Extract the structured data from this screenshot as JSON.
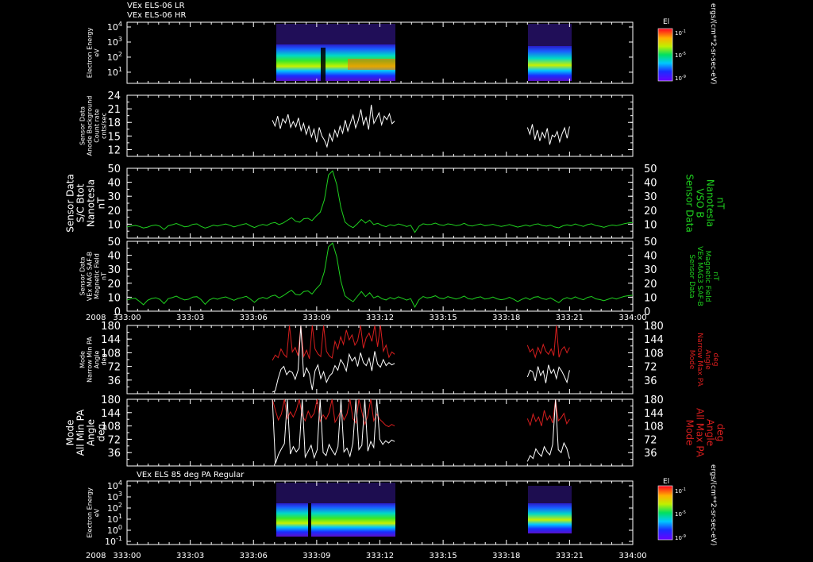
{
  "header": {
    "line1": "VEx ELS-06 LR",
    "line2": "VEx ELS-06 HR"
  },
  "time_axis": {
    "year": "2008",
    "ticks": [
      "333:00",
      "333:03",
      "333:06",
      "333:09",
      "333:12",
      "333:15",
      "333:18",
      "333:21",
      "334:00"
    ]
  },
  "colorbar_units": "ergs/(cm**2-sr-sec-eV)",
  "colors": {
    "green": "#1fd21f",
    "red": "#d81e1e",
    "white": "#ffffff",
    "black": "#000000"
  },
  "chart_data": [
    {
      "type": "heatmap",
      "id": "spec1",
      "ylabel": [
        "Electron Energy",
        "eV"
      ],
      "yticks": [
        "10^4",
        "10^3",
        "10^2",
        "10^1"
      ],
      "colorbar": {
        "label": "El",
        "ticks": [
          "10^-1",
          "10^-5",
          "10^-9"
        ]
      },
      "data_intervals": [
        [
          "333:06.9",
          "333:12.7"
        ],
        [
          "333:19.0",
          "333:21.0"
        ]
      ],
      "note_features": [
        {
          "t": 9.4,
          "kind": "dropout"
        },
        {
          "t": 10.2,
          "kind": "low-energy enhancement"
        }
      ]
    },
    {
      "type": "line",
      "id": "bkg",
      "ylabel": [
        "Sensor Data",
        "Anode Background",
        "Count rate",
        "cnts/sec"
      ],
      "yticks": [
        24,
        21,
        18,
        15,
        12
      ],
      "ylim": [
        10.5,
        24
      ],
      "series": [
        {
          "color": "white",
          "segments": [
            {
              "x_start": 6.9,
              "x_end": 12.7,
              "values": [
                18.5,
                17.2,
                19.4,
                16.6,
                18.8,
                17.9,
                19.8,
                16.9,
                18.2,
                17.0,
                19.0,
                16.2,
                17.8,
                15.4,
                17.2,
                14.8,
                16.5,
                13.6,
                16.9,
                15.0,
                14.1,
                12.6,
                15.5,
                13.9,
                16.3,
                14.8,
                17.2,
                15.6,
                18.5,
                16.1,
                17.9,
                19.6,
                16.8,
                18.4,
                20.9,
                17.5,
                19.1,
                16.4,
                21.9,
                17.8,
                18.9,
                20.1,
                17.5,
                19.4,
                18.6,
                19.9,
                17.7,
                18.3
              ]
            },
            {
              "x_start": 19.0,
              "x_end": 21.0,
              "values": [
                16.9,
                15.4,
                17.6,
                14.2,
                16.3,
                13.9,
                15.8,
                14.6,
                16.7,
                13.1,
                15.2,
                14.8,
                16.0,
                13.7,
                15.5,
                16.8,
                14.5,
                17.1
              ]
            }
          ]
        }
      ]
    },
    {
      "type": "line",
      "id": "bvso",
      "ylabel": [
        "Sensor Data",
        "S/C Btot",
        "Nanotesla",
        "nT"
      ],
      "rlabel": [
        "Sensor Data",
        "VSO B",
        "Nanotesla",
        "nT"
      ],
      "yticks": [
        50,
        40,
        30,
        20,
        10
      ],
      "ylim": [
        0,
        50
      ],
      "series": [
        {
          "color": "green",
          "values": [
            8.2,
            8.7,
            9.1,
            8.4,
            7.3,
            7.9,
            9.0,
            9.4,
            8.6,
            6.2,
            8.8,
            9.6,
            10.5,
            9.3,
            8.1,
            8.5,
            9.9,
            10.2,
            8.4,
            7.2,
            8.1,
            9.3,
            8.7,
            9.5,
            10.1,
            9.2,
            8.0,
            8.9,
            9.7,
            10.4,
            8.8,
            7.6,
            8.9,
            9.8,
            9.1,
            10.6,
            11.2,
            9.7,
            10.9,
            12.8,
            14.6,
            12.1,
            11.4,
            13.9,
            14.2,
            12.5,
            15.8,
            18.6,
            27.5,
            45.2,
            48.1,
            38.4,
            22.1,
            11.6,
            9.0,
            7.5,
            10.2,
            13.4,
            10.8,
            12.9,
            9.7,
            10.6,
            9.1,
            8.2,
            9.6,
            8.9,
            10.1,
            9.4,
            8.3,
            9.2,
            4.1,
            8.5,
            10.3,
            9.7,
            9.9,
            10.8,
            9.6,
            9.1,
            10.2,
            9.8,
            8.9,
            9.4,
            10.6,
            9.1,
            8.7,
            9.5,
            10.1,
            8.9,
            9.3,
            9.9,
            9.0,
            8.4,
            8.9,
            9.7,
            8.8,
            7.9,
            8.6,
            9.4,
            8.5,
            9.8,
            10.2,
            9.1,
            8.6,
            9.3,
            8.0,
            7.4,
            8.8,
            9.5,
            8.9,
            10.1,
            9.2,
            8.4,
            9.7,
            10.3,
            9.0,
            8.5,
            7.8,
            8.7,
            9.4,
            8.9,
            9.6,
            10.4,
            10.9,
            11.2
          ]
        }
      ]
    },
    {
      "type": "line",
      "id": "bmag",
      "ylabel": [
        "Sensor Data",
        "VEx MAG SAF-B",
        "Magnetic Field",
        "nT"
      ],
      "rlabel": [
        "Sensor Data",
        "VEx MAG3 SAF-B",
        "Magnetic Field",
        "nT"
      ],
      "yticks": [
        50,
        40,
        30,
        20,
        10,
        0
      ],
      "ylim": [
        0,
        50
      ],
      "series": [
        {
          "color": "green",
          "values": [
            8.0,
            8.9,
            9.2,
            7.1,
            4.6,
            7.8,
            9.1,
            9.6,
            8.4,
            5.4,
            8.9,
            9.7,
            10.8,
            9.2,
            8.0,
            8.6,
            10.1,
            10.4,
            8.3,
            4.9,
            8.0,
            9.4,
            8.5,
            9.6,
            10.2,
            9.0,
            7.8,
            9.1,
            9.8,
            10.6,
            8.6,
            6.3,
            8.8,
            9.9,
            9.0,
            10.7,
            11.5,
            9.5,
            11.1,
            13.2,
            15.0,
            12.0,
            11.6,
            14.1,
            14.5,
            12.3,
            16.0,
            19.1,
            28.4,
            46.0,
            48.8,
            39.0,
            21.6,
            11.0,
            8.6,
            6.8,
            10.5,
            14.1,
            10.4,
            13.2,
            9.5,
            10.8,
            8.9,
            8.0,
            9.8,
            8.7,
            10.3,
            9.2,
            7.9,
            9.0,
            2.9,
            8.2,
            10.5,
            9.5,
            10.0,
            11.0,
            9.4,
            8.9,
            10.4,
            9.6,
            8.7,
            9.5,
            10.8,
            8.9,
            8.5,
            9.7,
            10.3,
            8.7,
            9.1,
            10.1,
            8.8,
            8.2,
            8.7,
            9.9,
            8.6,
            6.9,
            8.4,
            9.6,
            8.3,
            10.0,
            10.4,
            8.9,
            8.4,
            9.5,
            7.8,
            6.1,
            8.6,
            9.7,
            8.7,
            10.3,
            9.0,
            8.2,
            9.9,
            10.5,
            8.8,
            8.3,
            7.5,
            8.5,
            9.6,
            8.7,
            9.8,
            10.6,
            11.1,
            11.4
          ]
        }
      ]
    },
    {
      "type": "line",
      "id": "pa1",
      "ylabel": [
        "Mode",
        "Narrow Min PA",
        "Angle",
        "deg"
      ],
      "rlabel": [
        "Mode",
        "Narrow Max PA",
        "Angle",
        "deg"
      ],
      "yticks": [
        180,
        144,
        108,
        72,
        36
      ],
      "ylim": [
        0,
        180
      ],
      "series": [
        {
          "name": "max",
          "color": "red",
          "segments": [
            {
              "x_start": 6.9,
              "x_end": 12.7,
              "values": [
                88,
                102,
                95,
                118,
                104,
                96,
                180,
                110,
                122,
                100,
                180,
                98,
                115,
                92,
                180,
                118,
                105,
                98,
                180,
                112,
                100,
                94,
                138,
                118,
                150,
                130,
                168,
                142,
                155,
                128,
                140,
                180,
                120,
                148,
                160,
                138,
                180,
                124,
                180,
                112,
                128,
                96,
                110,
                104
              ]
            },
            {
              "x_start": 19.0,
              "x_end": 21.0,
              "values": [
                128,
                110,
                118,
                96,
                122,
                106,
                130,
                112,
                104,
                118,
                100,
                180,
                96,
                116,
                124,
                108,
                122
              ]
            }
          ]
        },
        {
          "name": "min",
          "color": "white",
          "segments": [
            {
              "x_start": 6.9,
              "x_end": 12.7,
              "values": [
                4,
                8,
                40,
                64,
                72,
                50,
                60,
                56,
                38,
                62,
                180,
                44,
                68,
                52,
                10,
                60,
                76,
                40,
                58,
                30,
                46,
                54,
                74,
                62,
                90,
                78,
                60,
                104,
                86,
                96,
                72,
                108,
                82,
                74,
                94,
                60,
                112,
                78,
                70,
                90,
                74,
                82,
                76,
                80
              ]
            },
            {
              "x_start": 19.0,
              "x_end": 21.0,
              "values": [
                44,
                62,
                58,
                34,
                72,
                48,
                60,
                28,
                76,
                54,
                64,
                40,
                70,
                60,
                46,
                30,
                62
              ]
            }
          ]
        }
      ]
    },
    {
      "type": "line",
      "id": "pa2",
      "ylabel": [
        "Mode",
        "All Min PA",
        "Angle",
        "deg"
      ],
      "rlabel": [
        "Mode",
        "All Max PA",
        "Angle",
        "deg"
      ],
      "yticks": [
        180,
        144,
        108,
        72,
        36
      ],
      "ylim": [
        0,
        180
      ],
      "series": [
        {
          "name": "max",
          "color": "red",
          "segments": [
            {
              "x_start": 6.9,
              "x_end": 12.7,
              "values": [
                180,
                150,
                124,
                140,
                180,
                128,
                146,
                132,
                150,
                180,
                136,
                122,
                148,
                130,
                142,
                180,
                120,
                138,
                126,
                144,
                180,
                118,
                132,
                150,
                124,
                140,
                180,
                128,
                116,
                180,
                146,
                112,
                136,
                180,
                122,
                140,
                126,
                118,
                110,
                106,
                112,
                108
              ]
            },
            {
              "x_start": 19.0,
              "x_end": 21.0,
              "values": [
                128,
                110,
                140,
                120,
                132,
                108,
                150,
                124,
                136,
                116,
                180,
                122,
                130,
                142,
                114,
                126
              ]
            }
          ]
        },
        {
          "name": "min",
          "color": "white",
          "segments": [
            {
              "x_start": 6.9,
              "x_end": 12.7,
              "values": [
                180,
                6,
                30,
                46,
                60,
                180,
                32,
                52,
                38,
                48,
                180,
                24,
                40,
                56,
                22,
                44,
                180,
                36,
                28,
                58,
                42,
                30,
                52,
                180,
                38,
                48,
                26,
                62,
                180,
                44,
                56,
                180,
                40,
                66,
                50,
                180,
                72,
                58,
                68,
                62,
                70,
                66
              ]
            },
            {
              "x_start": 19.0,
              "x_end": 21.0,
              "values": [
                12,
                28,
                20,
                46,
                34,
                26,
                52,
                38,
                30,
                58,
                180,
                44,
                36,
                62,
                48,
                20
              ]
            }
          ]
        }
      ]
    },
    {
      "type": "heatmap",
      "id": "spec2",
      "title": "VEx ELS 85 deg PA Regular",
      "ylabel": [
        "Electron Energy",
        "eV"
      ],
      "yticks": [
        "10^4",
        "10^3",
        "10^2",
        "10^1",
        "10^0",
        "10^-1"
      ],
      "colorbar": {
        "label": "El",
        "ticks": [
          "10^-1",
          "10^-5",
          "10^-9"
        ]
      },
      "data_intervals": [
        [
          "333:06.9",
          "333:12.7"
        ],
        [
          "333:19.0",
          "333:21.0"
        ]
      ]
    }
  ]
}
